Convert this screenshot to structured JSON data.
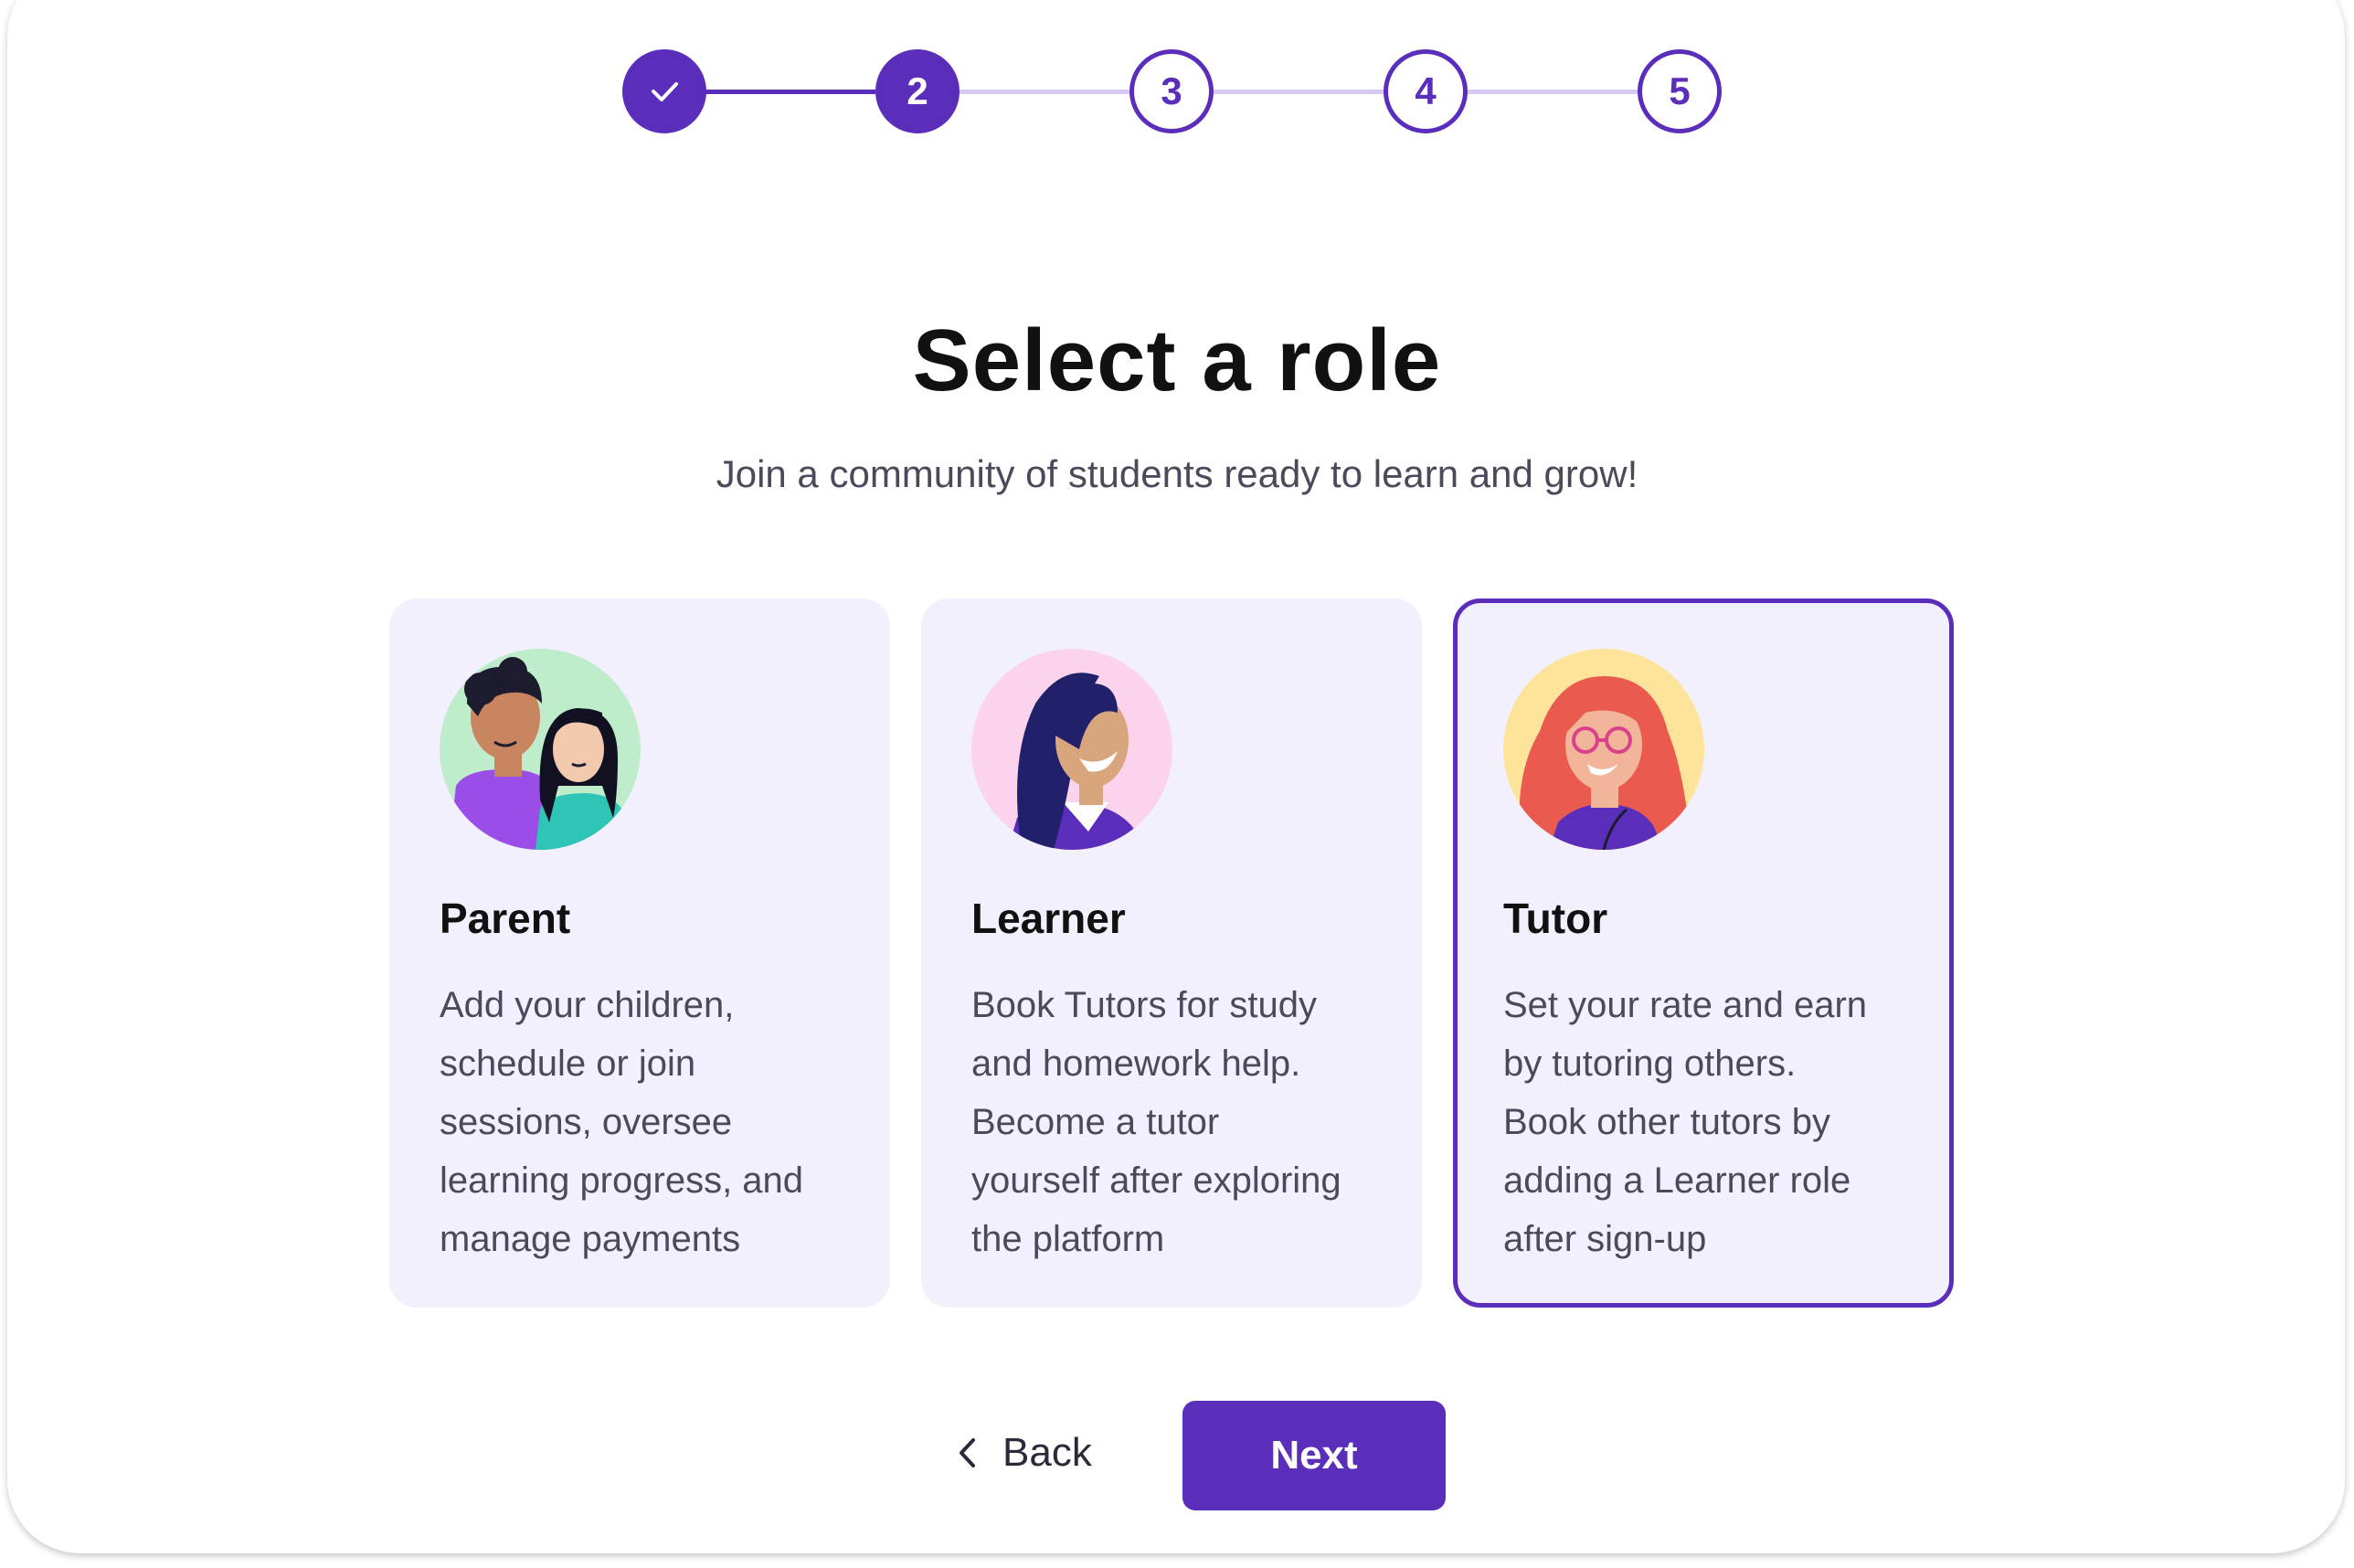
{
  "stepper": {
    "steps": [
      {
        "label": "",
        "state": "done"
      },
      {
        "label": "2",
        "state": "current"
      },
      {
        "label": "3",
        "state": "todo"
      },
      {
        "label": "4",
        "state": "todo"
      },
      {
        "label": "5",
        "state": "todo"
      }
    ],
    "current_step": 2,
    "total_steps": 5
  },
  "heading": {
    "title": "Select a role",
    "subtitle": "Join a community of students ready to learn and grow!"
  },
  "roles": [
    {
      "title": "Parent",
      "lines": [
        "Add your children,",
        "schedule or join",
        "sessions, oversee",
        "learning progress, and",
        "manage payments"
      ],
      "avatar": "parent-avatar-illustration",
      "selected": false
    },
    {
      "title": "Learner",
      "lines": [
        "Book Tutors for study",
        "and homework help.",
        "Become a tutor",
        "yourself after exploring",
        "the platform"
      ],
      "avatar": "learner-avatar-illustration",
      "selected": false
    },
    {
      "title": "Tutor",
      "lines": [
        "Set your rate and earn",
        "by tutoring others.",
        "Book other tutors by",
        "adding a Learner role",
        "after sign-up"
      ],
      "avatar": "tutor-avatar-illustration",
      "selected": true
    }
  ],
  "actions": {
    "back_label": "Back",
    "next_label": "Next",
    "back_icon": "chevron-left-icon"
  },
  "colors": {
    "accent": "#5b2dbb",
    "accent_light": "#d6c8f2",
    "card_bg": "#f3f0fd",
    "title_text": "#111111",
    "body_text": "#4a4a5a"
  }
}
